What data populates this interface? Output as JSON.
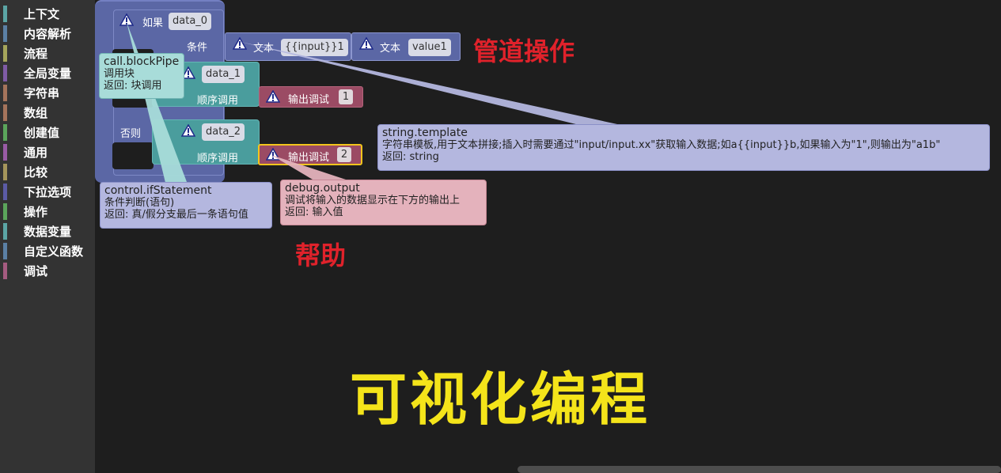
{
  "toolbox": {
    "categories": [
      {
        "label": "上下文",
        "color": "#5ba5a5"
      },
      {
        "label": "内容解析",
        "color": "#5b80a5"
      },
      {
        "label": "流程",
        "color": "#a5a55b"
      },
      {
        "label": "全局变量",
        "color": "#7f5ba5"
      },
      {
        "label": "字符串",
        "color": "#a5745b"
      },
      {
        "label": "数组",
        "color": "#a5745b"
      },
      {
        "label": "创建值",
        "color": "#5ba55b"
      },
      {
        "label": "通用",
        "color": "#995ba5"
      },
      {
        "label": "比较",
        "color": "#a5955b"
      },
      {
        "label": "下拉选项",
        "color": "#5b5ba5"
      },
      {
        "label": "操作",
        "color": "#5ba55b"
      },
      {
        "label": "数据变量",
        "color": "#5ba5a5"
      },
      {
        "label": "自定义函数",
        "color": "#5b80a5"
      },
      {
        "label": "调试",
        "color": "#a55b80"
      }
    ]
  },
  "blocks": {
    "if": {
      "title": "如果",
      "var": "data_0",
      "cond_label": "条件",
      "else_label": "否则"
    },
    "string1": {
      "label": "文本",
      "value": "{{input}}1"
    },
    "string2": {
      "label": "文本",
      "value": "value1"
    },
    "pipe1": {
      "var": "data_1",
      "seq_label": "顺序调用"
    },
    "pipe2": {
      "var": "data_2",
      "seq_label": "顺序调用"
    },
    "debug1": {
      "label": "输出调试",
      "value": "1"
    },
    "debug2": {
      "label": "输出调试",
      "value": "2"
    }
  },
  "tooltips": {
    "pipe": {
      "title": "call.blockPipe",
      "line1": "调用块",
      "line2": "返回: 块调用"
    },
    "if": {
      "title": "control.ifStatement",
      "line1": "条件判断(语句)",
      "line2": "返回: 真/假分支最后一条语句值"
    },
    "debug": {
      "title": "debug.output",
      "line1": "调试将输入的数据显示在下方的输出上",
      "line2": "返回: 输入值"
    },
    "string": {
      "title": "string.template",
      "line1": "字符串模板,用于文本拼接;插入时需要通过\"input/input.xx\"获取输入数据;如a{{input}}b,如果输入为\"1\",则输出为\"a1b\"",
      "line2": "返回: string"
    }
  },
  "annotations": {
    "pipe_ops": "管道操作",
    "help": "帮助",
    "title": "可视化编程"
  },
  "colors": {
    "if_block": "#5b67a5",
    "pipe_block": "#4a9d9d",
    "debug_block": "#9b4b64",
    "selected_outline": "#f3c51c",
    "annotation_red": "#e0222b",
    "annotation_yellow": "#f4e41a"
  }
}
